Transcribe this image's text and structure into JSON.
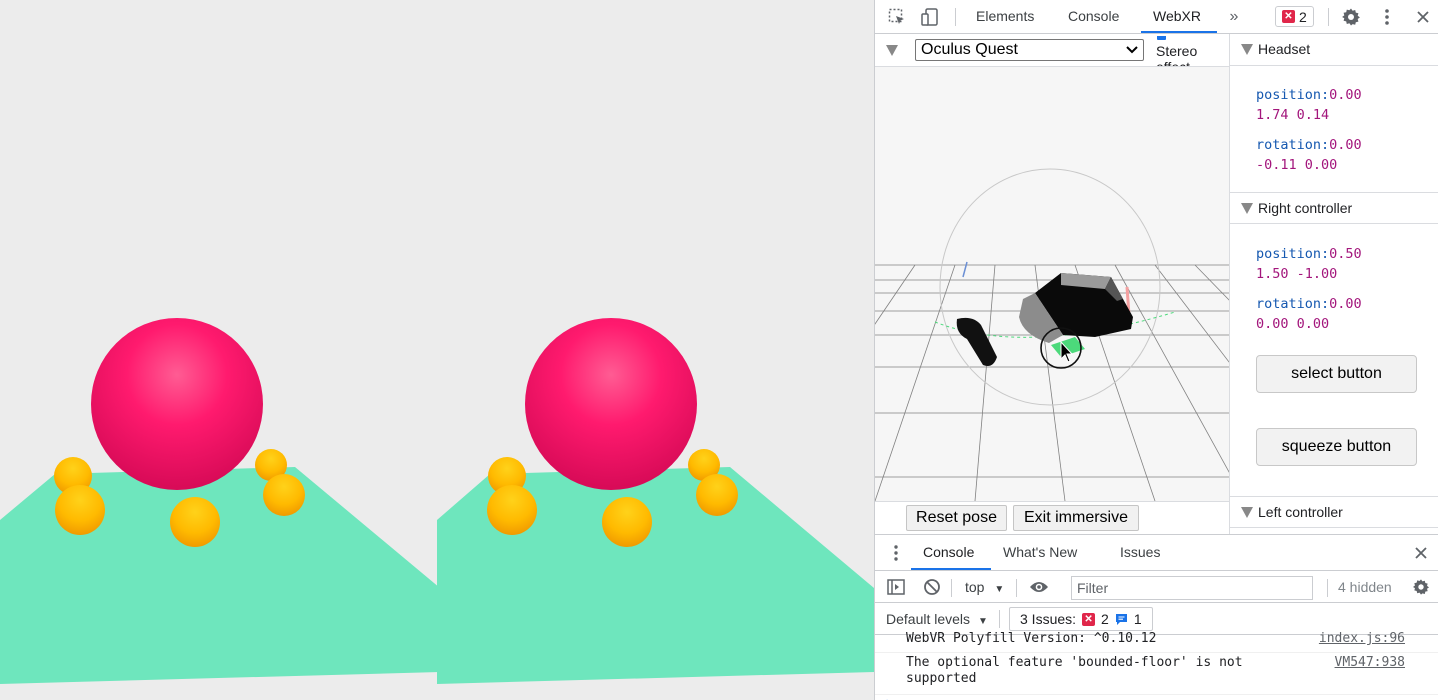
{
  "devtools": {
    "tabs": [
      "Elements",
      "Console",
      "WebXR"
    ],
    "active_tab": "WebXR",
    "more_tabs_icon": "double-chevron-right-icon",
    "error_count": "2",
    "icons": [
      "inspect-element-icon",
      "device-toolbar-icon",
      "gear-icon",
      "kebab-menu-icon",
      "close-icon"
    ]
  },
  "webxr": {
    "device": "Oculus Quest",
    "stereo_effect_label": "Stereo effect",
    "stereo_effect_checked": true,
    "reset_pose_label": "Reset pose",
    "exit_immersive_label": "Exit immersive"
  },
  "headset": {
    "title": "Headset",
    "position_key": "position:",
    "position_value_1": "0.00",
    "position_value_2": "1.74 0.14",
    "rotation_key": "rotation:",
    "rotation_value_1": "0.00",
    "rotation_value_2": "-0.11 0.00"
  },
  "right_controller": {
    "title": "Right controller",
    "position_key": "position:",
    "position_value_1": "0.50",
    "position_value_2": "1.50 -1.00",
    "rotation_key": "rotation:",
    "rotation_value_1": "0.00",
    "rotation_value_2": "0.00 0.00",
    "select_button_label": "select button",
    "squeeze_button_label": "squeeze button"
  },
  "left_controller": {
    "title": "Left controller"
  },
  "console_drawer": {
    "tabs": [
      "Console",
      "What's New",
      "Issues"
    ],
    "active_tab": "Console",
    "context": "top",
    "filter_placeholder": "Filter",
    "hidden_count": "4 hidden",
    "default_levels": "Default levels",
    "issues_label": "3 Issues:",
    "issues_errors": "2",
    "issues_messages": "1",
    "messages": [
      {
        "text": "WebVR Polyfill Version: ^0.10.12",
        "source": "index.js:96"
      },
      {
        "text": "The optional feature 'bounded-floor' is not supported",
        "source": "VM547:938"
      }
    ]
  },
  "colors": {
    "accent": "#1a73e8",
    "sphere": "#ff1a6e",
    "small_spheres": "#ffb300",
    "floor": "#6ee6bd",
    "error": "#e0264a"
  }
}
